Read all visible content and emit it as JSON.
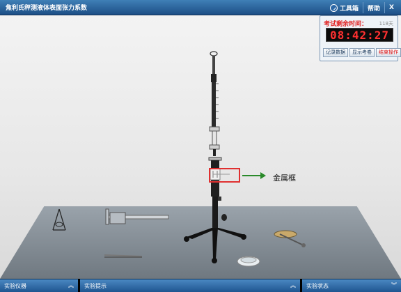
{
  "window": {
    "title": "焦利氏秤测液体表面张力系数",
    "toolbox_label": "工具箱",
    "help_label": "帮助",
    "close_label": "X"
  },
  "timer": {
    "label": "考试剩余时间：",
    "days": "118天",
    "display": "08:42:27",
    "buttons": [
      "记录数据",
      "显示考卷",
      "结束操作"
    ]
  },
  "annotation": {
    "label": "金属框"
  },
  "bottom_bars": {
    "instruments": "实验仪器",
    "hints": "实验提示",
    "status": "实验状态"
  },
  "colors": {
    "titlebar": "#2b67a6",
    "timer_red": "#e02020",
    "annotation_box": "#e03030",
    "arrow": "#2a8a2a"
  }
}
